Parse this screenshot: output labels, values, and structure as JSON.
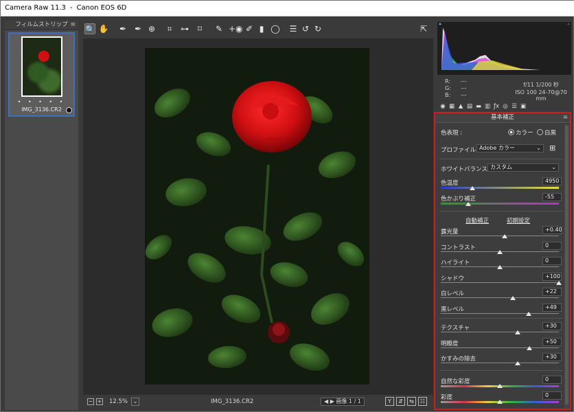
{
  "window": {
    "app": "Camera Raw 11.3",
    "sep": "-",
    "camera": "Canon EOS 6D"
  },
  "filmstrip": {
    "title": "フィルムストリップ",
    "item": {
      "filename": "IMG_3136.CR2",
      "stars": "• • • • •"
    }
  },
  "toolbar": {
    "tools": [
      {
        "name": "zoom-tool",
        "glyph": "🔍"
      },
      {
        "name": "hand-tool",
        "glyph": "✋"
      },
      {
        "name": "white-balance-tool",
        "glyph": "✒"
      },
      {
        "name": "color-sampler-tool",
        "glyph": "✒"
      },
      {
        "name": "targeted-adjustment-tool",
        "glyph": "⊕"
      },
      {
        "name": "crop-tool",
        "glyph": "⌗"
      },
      {
        "name": "straighten-tool",
        "glyph": "⊶"
      },
      {
        "name": "transform-tool",
        "glyph": "⌑"
      },
      {
        "name": "spot-removal-tool",
        "glyph": "✎"
      },
      {
        "name": "red-eye-tool",
        "glyph": "+◉"
      },
      {
        "name": "adjustment-brush-tool",
        "glyph": "✐"
      },
      {
        "name": "graduated-filter-tool",
        "glyph": "▮"
      },
      {
        "name": "radial-filter-tool",
        "glyph": "◯"
      },
      {
        "name": "preferences-icon",
        "glyph": "☰"
      },
      {
        "name": "rotate-ccw-icon",
        "glyph": "↺"
      },
      {
        "name": "rotate-cw-icon",
        "glyph": "↻"
      }
    ],
    "fullscreen_glyph": "⇱"
  },
  "bottom": {
    "zoom": "12.5%",
    "filename": "IMG_3136.CR2",
    "nav": "◀ ▶  画像 1 / 1",
    "btns": [
      "Y",
      "⇵",
      "⇆",
      "☷"
    ]
  },
  "info": {
    "r": "R:",
    "g": "G:",
    "b": "B:",
    "r_val": "---",
    "g_val": "---",
    "b_val": "---",
    "line1": "f/11   1/200 秒",
    "line2": "ISO 100   24-70@70 mm"
  },
  "panel": {
    "title": "基本補正",
    "color_mode_label": "色表現 :",
    "color_opt": "カラー",
    "bw_opt": "白黒",
    "profile_label": "プロファイル :",
    "profile_value": "Adobe カラー",
    "wb_label": "ホワイトバランス :",
    "wb_value": "カスタム",
    "temp_label": "色温度",
    "temp_value": "4950",
    "temp_pos": 0.27,
    "tint_label": "色かぶり補正",
    "tint_value": "-55",
    "tint_pos": 0.23,
    "auto_link": "自動補正",
    "default_link": "初期設定",
    "sliders": [
      {
        "label": "露光量",
        "value": "+0.40",
        "pos": 0.54
      },
      {
        "label": "コントラスト",
        "value": "0",
        "pos": 0.5
      },
      {
        "label": "ハイライト",
        "value": "0",
        "pos": 0.5
      },
      {
        "label": "シャドウ",
        "value": "+100",
        "pos": 1.0
      },
      {
        "label": "白レベル",
        "value": "+22",
        "pos": 0.61
      },
      {
        "label": "黒レベル",
        "value": "+49",
        "pos": 0.745
      }
    ],
    "presence": [
      {
        "label": "テクスチャ",
        "value": "+30",
        "pos": 0.65
      },
      {
        "label": "明瞭度",
        "value": "+50",
        "pos": 0.75
      },
      {
        "label": "かすみの除去",
        "value": "+30",
        "pos": 0.65
      }
    ],
    "saturation": [
      {
        "label": "自然な彩度",
        "value": "0",
        "pos": 0.5
      },
      {
        "label": "彩度",
        "value": "0",
        "pos": 0.5
      }
    ]
  },
  "colors": {
    "highlight": "#d6191c",
    "selection": "#3e6fc5"
  }
}
